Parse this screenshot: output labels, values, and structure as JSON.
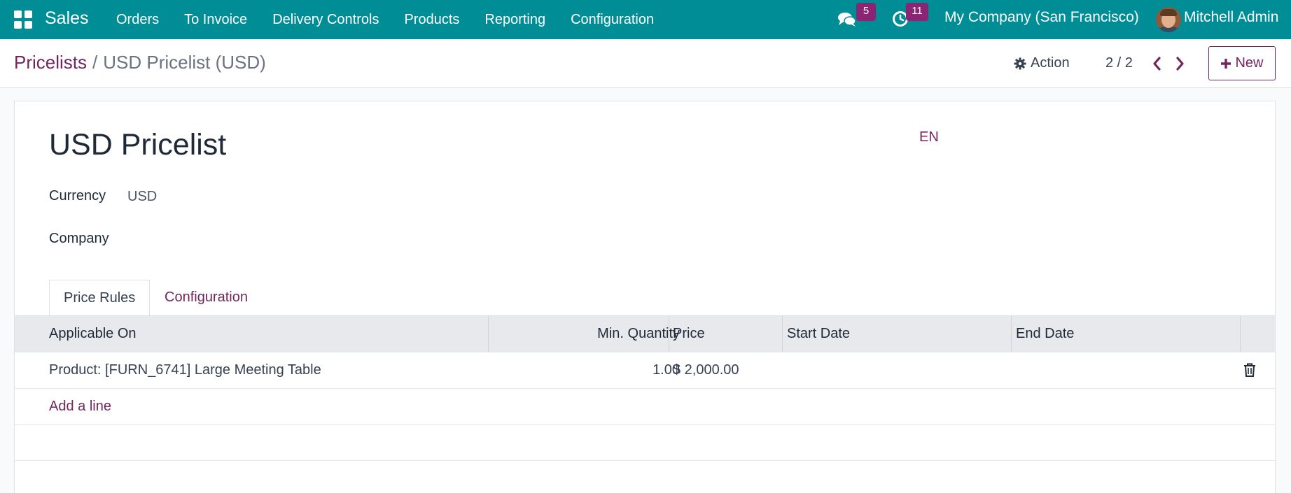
{
  "navbar": {
    "app_name": "Sales",
    "menu": [
      "Orders",
      "To Invoice",
      "Delivery Controls",
      "Products",
      "Reporting",
      "Configuration"
    ],
    "messages_count": "5",
    "activities_count": "11",
    "company": "My Company (San Francisco)",
    "user": "Mitchell Admin",
    "background_color": "#018d96"
  },
  "control_panel": {
    "breadcrumb_parent": "Pricelists",
    "breadcrumb_separator": "/",
    "breadcrumb_current": "USD Pricelist (USD)",
    "action_label": "Action",
    "pager": "2 / 2",
    "new_label": "New"
  },
  "form": {
    "title": "USD Pricelist",
    "language": "EN",
    "currency_label": "Currency",
    "currency_value": "USD",
    "company_label": "Company",
    "company_value": ""
  },
  "tabs": [
    "Price Rules",
    "Configuration"
  ],
  "table": {
    "columns": [
      "Applicable On",
      "Min. Quantity",
      "Price",
      "Start Date",
      "End Date"
    ],
    "rows": [
      {
        "applicable_on": "Product: [FURN_6741] Large Meeting Table",
        "min_quantity": "1.00",
        "price": "$ 2,000.00",
        "start_date": "",
        "end_date": ""
      }
    ],
    "add_line_label": "Add a line"
  },
  "colors": {
    "primary": "#71275e",
    "badge": "#8a2473"
  }
}
